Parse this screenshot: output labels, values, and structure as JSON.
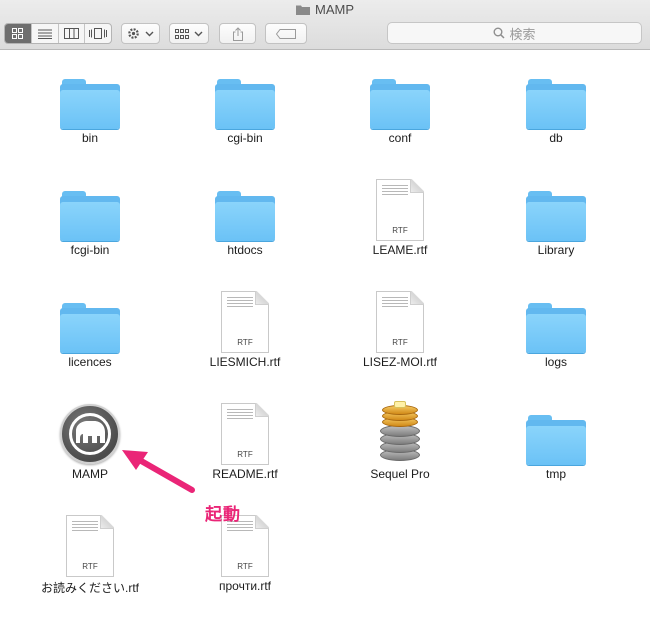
{
  "window": {
    "title": "MAMP"
  },
  "toolbar": {
    "view_modes": [
      "icon-view",
      "list-view",
      "column-view",
      "cover-flow-view"
    ],
    "search_placeholder": "検索"
  },
  "items": [
    {
      "label": "bin",
      "type": "folder"
    },
    {
      "label": "cgi-bin",
      "type": "folder"
    },
    {
      "label": "conf",
      "type": "folder"
    },
    {
      "label": "db",
      "type": "folder"
    },
    {
      "label": "fcgi-bin",
      "type": "folder"
    },
    {
      "label": "htdocs",
      "type": "folder"
    },
    {
      "label": "LEAME.rtf",
      "type": "document",
      "ext": "RTF"
    },
    {
      "label": "Library",
      "type": "folder"
    },
    {
      "label": "licences",
      "type": "folder"
    },
    {
      "label": "LIESMICH.rtf",
      "type": "document",
      "ext": "RTF"
    },
    {
      "label": "LISEZ-MOI.rtf",
      "type": "document",
      "ext": "RTF"
    },
    {
      "label": "logs",
      "type": "folder"
    },
    {
      "label": "MAMP",
      "type": "mamp-app"
    },
    {
      "label": "README.rtf",
      "type": "document",
      "ext": "RTF"
    },
    {
      "label": "Sequel Pro",
      "type": "sequel-app"
    },
    {
      "label": "tmp",
      "type": "folder"
    },
    {
      "label": "お読みください.rtf",
      "type": "document",
      "ext": "RTF"
    },
    {
      "label": "прочти.rtf",
      "type": "document",
      "ext": "RTF"
    }
  ],
  "annotation": {
    "text": "起動",
    "color": "#ea2577"
  },
  "colors": {
    "folder": "#6bc2f6",
    "accent": "#ea2577"
  }
}
